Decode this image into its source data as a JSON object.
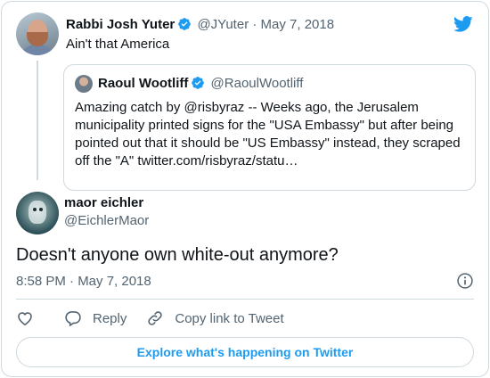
{
  "parent_tweet": {
    "author_name": "Rabbi Josh Yuter",
    "handle_date": "@JYuter · May 7, 2018",
    "text": "Ain't that America"
  },
  "quoted_tweet": {
    "author_name": "Raoul Wootliff",
    "handle": "@RaoulWootliff",
    "text": "Amazing catch by @risbyraz -- Weeks ago, the Jerusalem municipality printed signs for the \"USA Embassy\" but after being pointed out that it should be \"US Embassy\" instead, they scraped off the \"A\" twitter.com/risbyraz/statu…"
  },
  "main_tweet": {
    "author_name": "maor eichler",
    "handle": "@EichlerMaor",
    "text": "Doesn't anyone own white-out anymore?",
    "timestamp": "8:58 PM · May 7, 2018"
  },
  "actions": {
    "reply_label": "Reply",
    "copy_link_label": "Copy link to Tweet"
  },
  "explore_label": "Explore what's happening on Twitter",
  "icons": {
    "brand": "twitter-bird-icon",
    "verified": "verified-badge-icon",
    "info": "info-icon",
    "like": "heart-icon",
    "reply": "reply-icon",
    "link": "link-icon"
  },
  "colors": {
    "brand_blue": "#1d9bf0",
    "text_primary": "#0f1419",
    "text_secondary": "#536471",
    "border": "#cfd9de"
  }
}
